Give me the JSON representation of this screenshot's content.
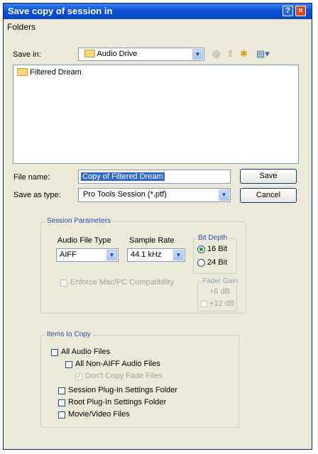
{
  "window": {
    "title": "Save copy of session in",
    "help_glyph": "?",
    "close_glyph": "×"
  },
  "menu": {
    "folders": "Folders"
  },
  "save_in": {
    "label": "Save in:",
    "value": "Audio Drive"
  },
  "toolbar": {
    "back_icon": "back-icon",
    "up_icon": "up-folder-icon",
    "new_folder_icon": "new-folder-icon",
    "view_icon": "view-menu-icon"
  },
  "file_list": {
    "items": [
      {
        "name": "Filtered Dream",
        "icon": "folder-icon"
      }
    ]
  },
  "file_name": {
    "label": "File name:",
    "value": "Copy of Filtered Dream"
  },
  "save_as_type": {
    "label": "Save as type:",
    "value": "Pro Tools Session (*.ptf)"
  },
  "buttons": {
    "save": "Save",
    "cancel": "Cancel"
  },
  "session_params": {
    "title": "Session Parameters",
    "audio_file_type": {
      "label": "Audio File Type",
      "value": "AIFF"
    },
    "sample_rate": {
      "label": "Sample Rate",
      "value": "44.1 kHz"
    },
    "bit_depth": {
      "title": "Bit Depth",
      "options": [
        "16 Bit",
        "24 Bit"
      ],
      "selected": "16 Bit"
    },
    "enforce_compat": {
      "label": "Enforce Mac/PC Compatibility",
      "checked": false,
      "enabled": false
    },
    "fader_gain": {
      "title": "Fader Gain",
      "options": [
        "+6 dB",
        "+12 dB"
      ],
      "enabled": false
    }
  },
  "items_to_copy": {
    "title": "Items to Copy",
    "all_audio_files": {
      "label": "All Audio Files",
      "checked": false
    },
    "all_non_aiff": {
      "label": "All Non-AIFF Audio Files",
      "checked": false
    },
    "dont_copy_fade": {
      "label": "Don't Copy Fade Files",
      "checked": true,
      "enabled": false
    },
    "session_plugin": {
      "label": "Session Plug-In Settings Folder",
      "checked": false
    },
    "root_plugin": {
      "label": "Root Plug-In Settings Folder",
      "checked": false
    },
    "movie_video": {
      "label": "Movie/Video Files",
      "checked": false
    }
  },
  "colors": {
    "title_bar": "#0a52d6",
    "dialog_bg": "#ece9d8",
    "selection": "#316ac5",
    "group_title": "#2a4bb8"
  }
}
